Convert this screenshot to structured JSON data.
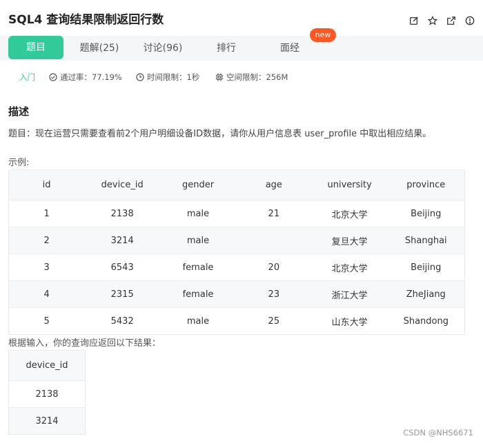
{
  "header": {
    "title": "SQL4  查询结果限制返回行数",
    "icons": [
      "edit-icon",
      "star-icon",
      "external-link-icon",
      "info-icon"
    ]
  },
  "tabs": [
    {
      "label": "题目",
      "active": true
    },
    {
      "label": "题解(25)",
      "active": false
    },
    {
      "label": "讨论(96)",
      "active": false
    },
    {
      "label": "排行",
      "active": false
    },
    {
      "label": "面经",
      "active": false
    }
  ],
  "badge": "new",
  "meta": {
    "level": "入门",
    "pass_rate": "通过率：77.19%",
    "time_limit": "时间限制：1秒",
    "space_limit": "空间限制：256M"
  },
  "description": {
    "heading": "描述",
    "text": "题目：现在运营只需要查看前2个用户明细设备ID数据，请你从用户信息表 user_profile 中取出相应结果。",
    "example_label": "示例:",
    "result_label": "根据输入，你的查询应返回以下结果："
  },
  "example_table": {
    "columns": [
      "id",
      "device_id",
      "gender",
      "age",
      "university",
      "province"
    ],
    "rows": [
      [
        "1",
        "2138",
        "male",
        "21",
        "北京大学",
        "Beijing"
      ],
      [
        "2",
        "3214",
        "male",
        "",
        "复旦大学",
        "Shanghai"
      ],
      [
        "3",
        "6543",
        "female",
        "20",
        "北京大学",
        "Beijing"
      ],
      [
        "4",
        "2315",
        "female",
        "23",
        "浙江大学",
        "ZheJiang"
      ],
      [
        "5",
        "5432",
        "male",
        "25",
        "山东大学",
        "Shandong"
      ]
    ]
  },
  "result_table": {
    "columns": [
      "device_id"
    ],
    "rows": [
      [
        "2138"
      ],
      [
        "3214"
      ]
    ]
  },
  "watermark": "CSDN @NHS6671",
  "colors": {
    "accent": "#32ca99",
    "badge": "#ff5722"
  }
}
